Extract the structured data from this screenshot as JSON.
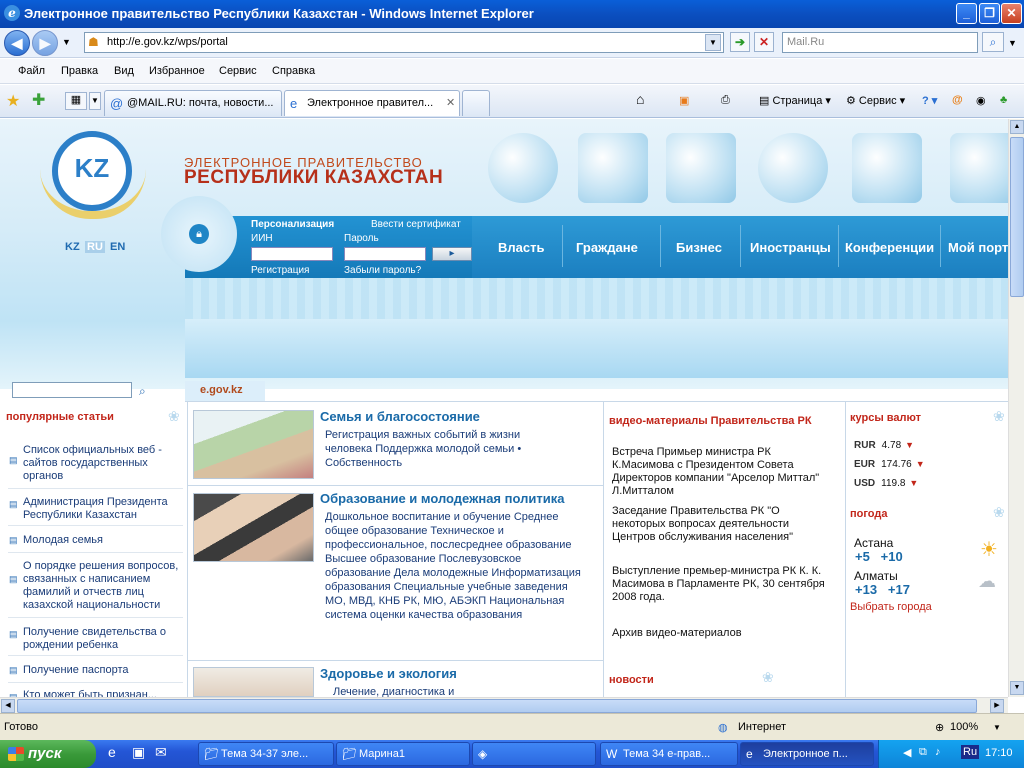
{
  "window": {
    "title": "Электронное правительство Республики Казахстан - Windows Internet Explorer"
  },
  "address": {
    "url": "http://e.gov.kz/wps/portal",
    "search_placeholder": "Mail.Ru"
  },
  "menu": [
    "Файл",
    "Правка",
    "Вид",
    "Избранное",
    "Сервис",
    "Справка"
  ],
  "tabs": [
    {
      "label": "@MAIL.RU: почта, новости..."
    },
    {
      "label": "Электронное правител..."
    }
  ],
  "toolbar": {
    "page_label": "Страница",
    "service_label": "Сервис"
  },
  "site": {
    "title_line1": "ЭЛЕКТРОННОЕ ПРАВИТЕЛЬСТВО",
    "title_line2": "РЕСПУБЛИКИ КАЗАХСТАН",
    "logo_text": "KZ",
    "languages": [
      "KZ",
      "RU",
      "EN"
    ],
    "login": {
      "personalization": "Персонализация",
      "cert": "Ввести сертификат",
      "iin": "ИИН",
      "password": "Пароль",
      "register": "Регистрация",
      "forgot": "Забыли пароль?",
      "go": "▸"
    },
    "nav": [
      "Власть",
      "Граждане",
      "Бизнес",
      "Иностранцы",
      "Конференции",
      "Мой порт"
    ],
    "breadcrumb": "e.gov.kz"
  },
  "left": {
    "popular_title": "популярные статьи",
    "links": [
      "Список официальных веб - сайтов государственных органов",
      "Администрация Президента Республики Казахстан",
      "Молодая семья",
      "О порядке решения вопросов, связанных с написанием фамилий и отчеств лиц казахской национальности",
      "Получение свидетельства о рождении ребенка",
      "Получение паспорта",
      "Кто может быть признан..."
    ]
  },
  "center": {
    "sections": [
      {
        "title": "Семья и благосостояние",
        "links_text": "Регистрация важных событий в жизни человека   Поддержка молодой семьи   • Собственность"
      },
      {
        "title": "Образование и молодежная политика",
        "links_text": "Дошкольное воспитание и обучение   Среднее общее образование   Техническое и профессиональное, послесреднее образование   Высшее образование   Послевузовское образование   Дела молодежные   Информатизация образования   Специальные учебные заведения МО, МВД, КНБ РК, МЮ, АБЭКП   Национальная система оценки качества образования"
      },
      {
        "title": "Здоровье и экология",
        "links_text": "Лечение, диагностика и"
      }
    ]
  },
  "video": {
    "title": "видео-материалы Правительства РК",
    "items": [
      "Встреча Примьер министра РК К.Масимова с Президентом Совета Директоров компании \"Арселор Миттал\" Л.Митталом",
      "Заседание Правительства РК \"О некоторых вопросах деятельности Центров обслуживания населения\"",
      "Выступление премьер-министра РК К. К. Масимова в Парламенте РК, 30 сентября 2008 года.",
      "Архив видео-материалов"
    ],
    "news_title": "новости"
  },
  "right": {
    "rates_title": "курсы валют",
    "rates": [
      {
        "code": "RUR",
        "value": "4.78"
      },
      {
        "code": "EUR",
        "value": "174.76"
      },
      {
        "code": "USD",
        "value": "119.8"
      }
    ],
    "weather_title": "погода",
    "cities": [
      {
        "name": "Астана",
        "t1": "+5",
        "t2": "+10"
      },
      {
        "name": "Алматы",
        "t1": "+13",
        "t2": "+17"
      }
    ],
    "choose_city": "Выбрать города"
  },
  "status": {
    "left": "Готово",
    "zone": "Интернет",
    "zoom": "100%"
  },
  "taskbar": {
    "start": "пуск",
    "tasks": [
      "Тема 34-37 эле...",
      "Марина1",
      "",
      "Тема 34 е-прав...",
      "Электронное п..."
    ],
    "lang": "RU",
    "clock": "17:10",
    "tray_lang": "Ru"
  },
  "colors": {
    "brand_blue": "#1b7fc0",
    "title_red": "#b6301a",
    "link_blue": "#1a6aa8"
  }
}
